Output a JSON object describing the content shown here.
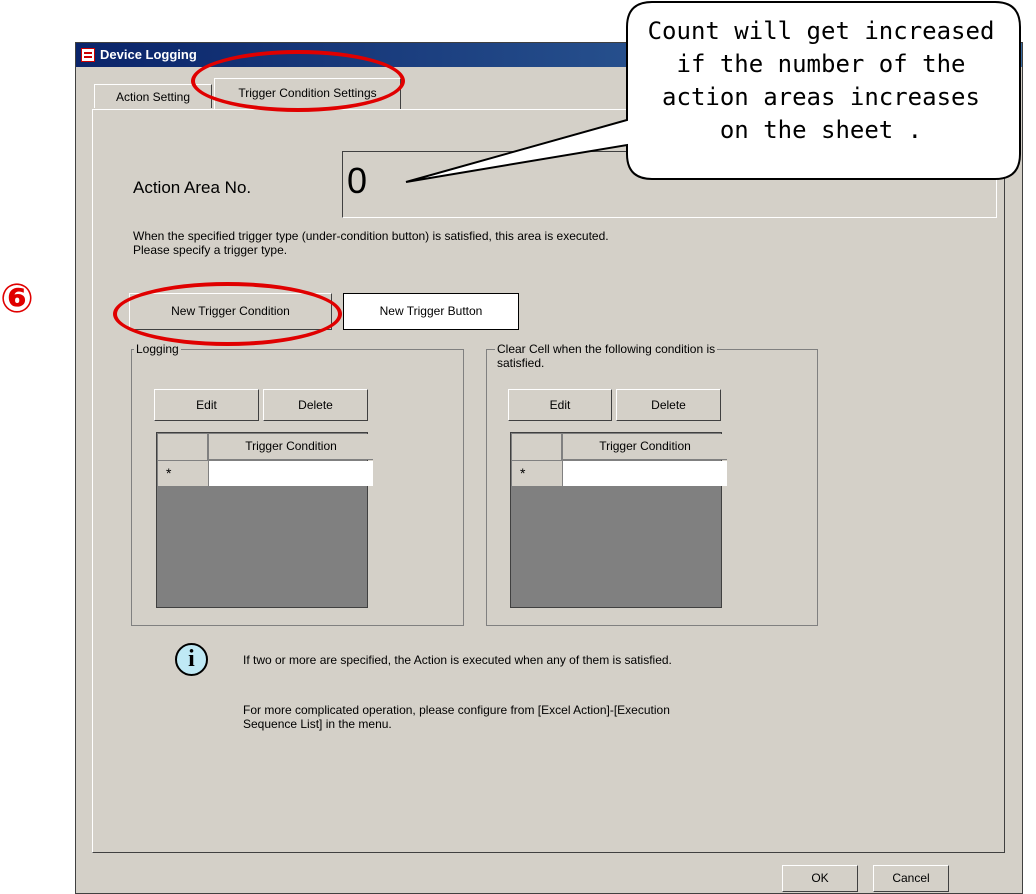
{
  "window": {
    "title": "Device Logging"
  },
  "tabs": [
    {
      "label": "Action Setting"
    },
    {
      "label": "Trigger Condition Settings"
    }
  ],
  "action_area": {
    "label": "Action Area No.",
    "value": "0"
  },
  "description": {
    "line1": "When the specified trigger type (under-condition button) is satisfied, this area is executed.",
    "line2": "Please specify a trigger type."
  },
  "buttons": {
    "new_trigger_condition": "New Trigger Condition",
    "new_trigger_button": "New Trigger Button",
    "ok": "OK",
    "cancel": "Cancel"
  },
  "logging_group": {
    "title": "Logging",
    "edit": "Edit",
    "delete": "Delete",
    "column_header": "Trigger Condition",
    "new_row_marker": "*"
  },
  "clear_group": {
    "title_line1": "Clear Cell when the following condition is",
    "title_line2": "satisfied.",
    "edit": "Edit",
    "delete": "Delete",
    "column_header": "Trigger Condition",
    "new_row_marker": "*"
  },
  "info": {
    "icon": "info-icon",
    "line1": "If two or more are specified, the Action is executed when any of them is satisfied.",
    "line2": "For more complicated operation, please configure from [Excel Action]-[Execution",
    "line3": "Sequence List] in the menu."
  },
  "annotations": {
    "step_number": "⑥",
    "callout": {
      "line1": "Count will get increased",
      "line2": "if the number of the",
      "line3": "action areas increases",
      "line4": "on the sheet ."
    },
    "highlight_color": "#e00000"
  }
}
